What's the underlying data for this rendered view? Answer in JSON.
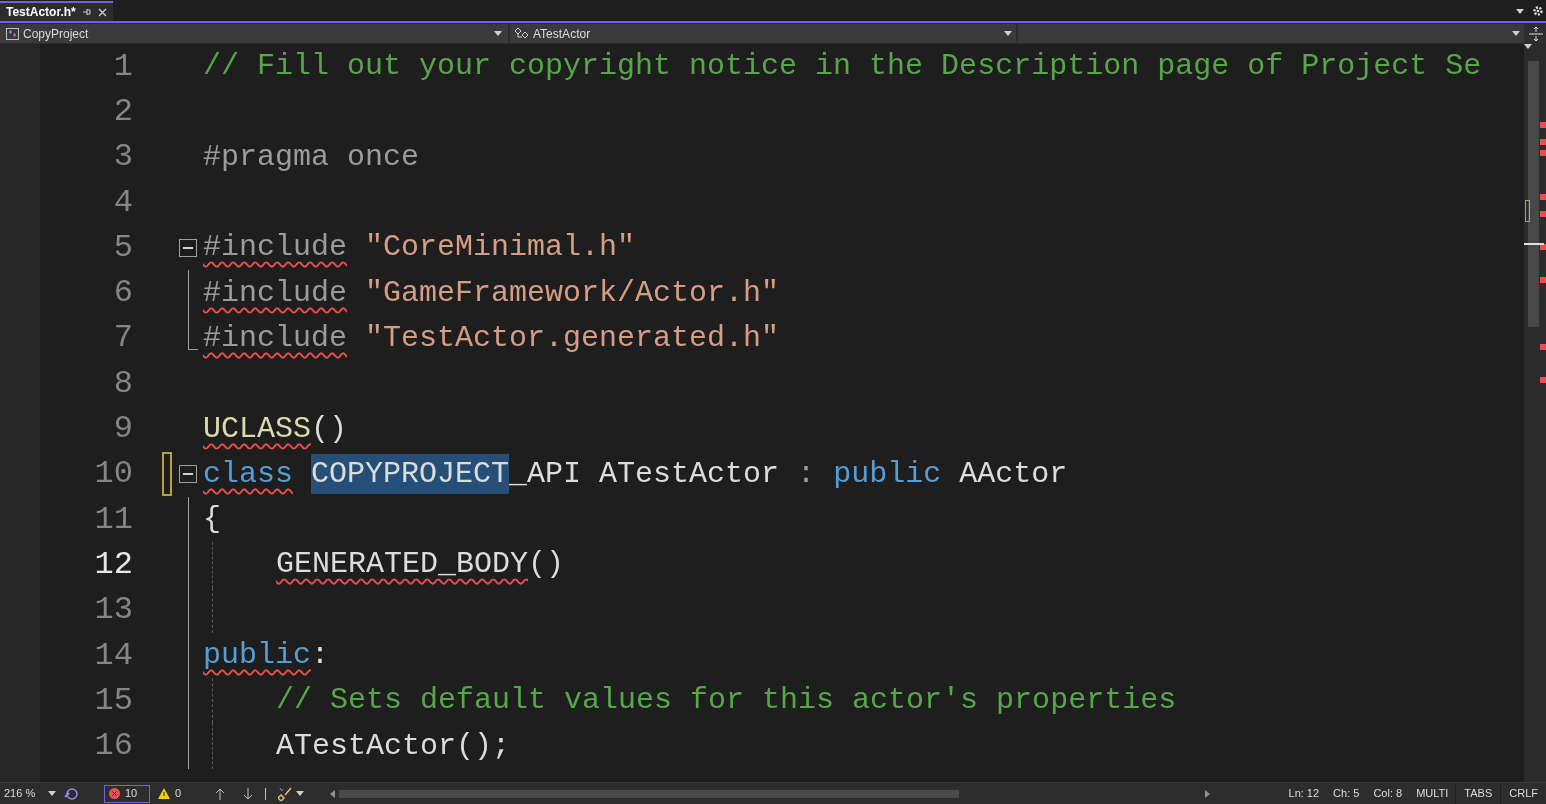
{
  "tab": {
    "title": "TestActor.h*",
    "selected": true
  },
  "nav": {
    "project": "CopyProject",
    "scope": "ATestActor"
  },
  "lines": [
    {
      "number": "1",
      "tokens": [
        {
          "text": "// Fill out your copyright notice in the Description page of Project Se",
          "kind": "comment"
        }
      ]
    },
    {
      "number": "2"
    },
    {
      "number": "3",
      "tokens": [
        {
          "text": "#pragma once",
          "kind": "preproc"
        }
      ]
    },
    {
      "number": "4"
    },
    {
      "number": "5",
      "fold_toggle": true,
      "tokens": [
        {
          "text": "#include",
          "kind": "preproc",
          "error": true
        },
        {
          "text": "\"CoreMinimal.h\"",
          "kind": "string",
          "spaced": true
        }
      ]
    },
    {
      "number": "6",
      "fold_line": true,
      "tokens": [
        {
          "text": "#include",
          "kind": "preproc",
          "error": true
        },
        {
          "text": "\"GameFramework/Actor.h\"",
          "kind": "string",
          "spaced": true
        }
      ]
    },
    {
      "number": "7",
      "fold_end": true,
      "tokens": [
        {
          "text": "#include",
          "kind": "preproc",
          "error": true
        },
        {
          "text": "\"TestActor.generated.h\"",
          "kind": "string",
          "spaced": true
        }
      ]
    },
    {
      "number": "8"
    },
    {
      "number": "9",
      "tokens": [
        {
          "text": "UCLASS",
          "kind": "macro",
          "error": true
        },
        {
          "text": "()",
          "kind": "plain"
        }
      ]
    },
    {
      "number": "10",
      "fold_toggle": true,
      "modified": true,
      "tokens": [
        {
          "text": "class",
          "kind": "keyword",
          "error": true
        },
        {
          "text": "COPYPROJECT",
          "kind": "plain",
          "selected": true,
          "spaced": true
        },
        {
          "text": "_API ATestActor",
          "kind": "plain"
        },
        {
          "text": ":",
          "kind": "punct",
          "spaced": true
        },
        {
          "text": "public",
          "kind": "keyword",
          "spaced": true
        },
        {
          "text": "AActor",
          "kind": "plain",
          "spaced": true
        }
      ]
    },
    {
      "number": "11",
      "fold_line": true,
      "tokens": [
        {
          "text": "{",
          "kind": "plain"
        }
      ]
    },
    {
      "number": "12",
      "fold_line": true,
      "current": true,
      "indented": true,
      "guide": true,
      "tokens": [
        {
          "text": "GENERATED_BODY",
          "kind": "plain",
          "error": true
        },
        {
          "text": "()",
          "kind": "plain"
        }
      ]
    },
    {
      "number": "13",
      "fold_line": true,
      "guide": true
    },
    {
      "number": "14",
      "fold_line": true,
      "tokens": [
        {
          "text": "public",
          "kind": "keyword",
          "error": true
        },
        {
          "text": ":",
          "kind": "plain"
        }
      ]
    },
    {
      "number": "15",
      "fold_line": true,
      "indented": true,
      "guide": true,
      "tokens": [
        {
          "text": "// Sets default values for this actor's properties",
          "kind": "comment"
        }
      ]
    },
    {
      "number": "16",
      "fold_line": true,
      "indented": true,
      "guide": true,
      "tokens": [
        {
          "text": "ATestActor();",
          "kind": "plain"
        }
      ]
    }
  ],
  "status": {
    "zoom": "216 %",
    "errors": "10",
    "warnings": "0",
    "line": "Ln: 12",
    "char": "Ch: 5",
    "col": "Col: 8",
    "mode": "MULTI",
    "indent": "TABS",
    "eol": "CRLF"
  }
}
